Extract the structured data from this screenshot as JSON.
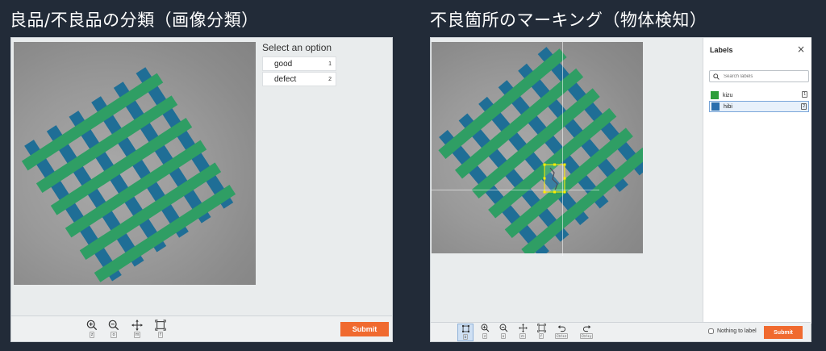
{
  "titles": {
    "left": "良品/不良品の分類（画像分類）",
    "right": "不良箇所のマーキング（物体検知）"
  },
  "classification": {
    "options_title": "Select an option",
    "options": [
      {
        "label": "good",
        "key": "1"
      },
      {
        "label": "defect",
        "key": "2"
      }
    ],
    "toolbar": [
      {
        "name": "zoom-in",
        "key": "z"
      },
      {
        "name": "zoom-out",
        "key": "o"
      },
      {
        "name": "pan",
        "key": "m"
      },
      {
        "name": "fit",
        "key": "f"
      }
    ],
    "submit": "Submit"
  },
  "detection": {
    "labels_header": "Labels",
    "close": "×",
    "search_placeholder": "Search labels",
    "labels": [
      {
        "name": "kizu",
        "color": "#2e9e3a",
        "key": "1"
      },
      {
        "name": "hibi",
        "color": "#2b6fae",
        "key": "2"
      }
    ],
    "toolbar": [
      {
        "name": "box",
        "key": "b"
      },
      {
        "name": "zoom-in",
        "key": "z"
      },
      {
        "name": "zoom-out",
        "key": "o"
      },
      {
        "name": "pan",
        "key": "m"
      },
      {
        "name": "fit",
        "key": "f"
      },
      {
        "name": "undo",
        "key": "Ctrl+z"
      },
      {
        "name": "redo",
        "key": "Ctrl+y"
      }
    ],
    "nothing_to_label": "Nothing to label",
    "submit": "Submit"
  },
  "colors": {
    "green_strip": "#2f9e64",
    "blue_strip": "#1f6e96",
    "submit": "#f06a2f",
    "bbox": "#ffee00"
  }
}
